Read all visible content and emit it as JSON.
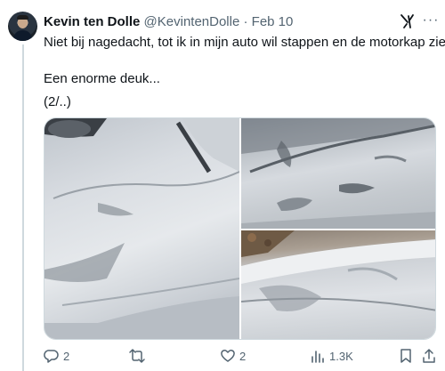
{
  "tweet": {
    "author_name": "Kevin ten Dolle",
    "handle": "@KevintenDolle",
    "separator": "·",
    "date": "Feb 10",
    "lines": [
      "Niet bij nagedacht, tot ik in mijn auto wil stappen en de motorkap zie.",
      "Een enorme deuk...",
      "(2/..)"
    ]
  },
  "actions": {
    "replies": "2",
    "reposts": "",
    "likes": "2",
    "views": "1.3K"
  },
  "icons": [
    "grok-icon",
    "more-icon",
    "reply-icon",
    "retweet-icon",
    "like-icon",
    "views-icon",
    "bookmark-icon",
    "share-icon"
  ],
  "colors": {
    "text": "#0f1419",
    "secondary": "#536471",
    "border": "#cfd9de"
  }
}
